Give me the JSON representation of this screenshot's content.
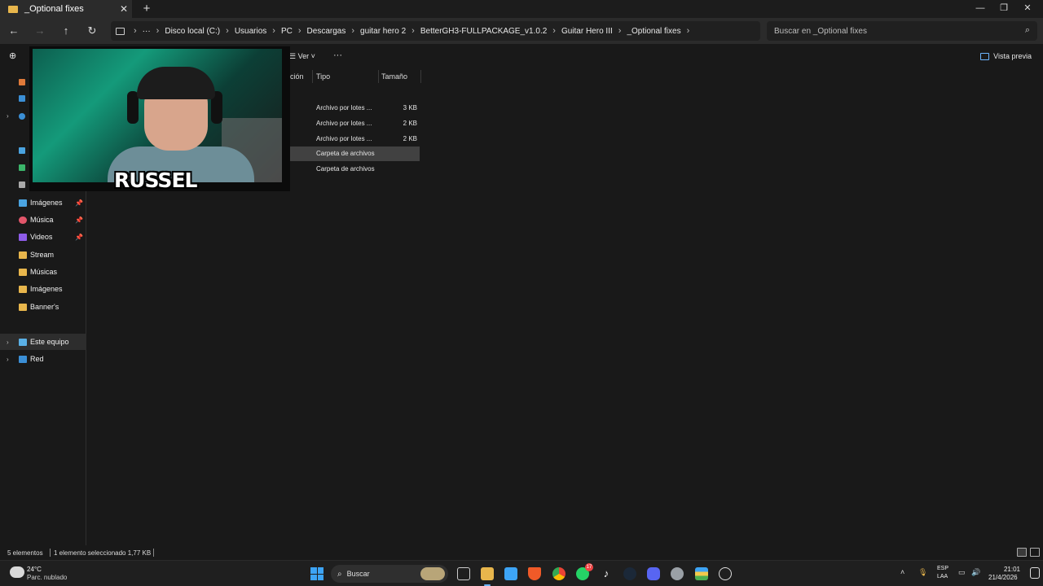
{
  "window": {
    "tab_title": "_Optional fixes",
    "tab_close": "✕",
    "new_tab": "+",
    "minimize": "—",
    "maximize": "❐",
    "close": "✕"
  },
  "address": {
    "crumbs": [
      "Disco local (C:)",
      "Usuarios",
      "PC",
      "Descargas",
      "guitar hero 2",
      "BetterGH3-FULLPACKAGE_v1.0.2",
      "Guitar Hero III",
      "_Optional fixes"
    ],
    "more": "···",
    "search_placeholder": "Buscar en _Optional fixes"
  },
  "toolbar": {
    "view_label": "Ver",
    "more_label": "···",
    "preview_label": "Vista previa"
  },
  "columns": {
    "partial_name": "ción",
    "type": "Tipo",
    "size": "Tamaño"
  },
  "files": [
    {
      "type": "Archivo por lotes ...",
      "size": "3 KB",
      "selected": false
    },
    {
      "type": "Archivo por lotes ...",
      "size": "2 KB",
      "selected": false
    },
    {
      "type": "Archivo por lotes ...",
      "size": "2 KB",
      "selected": false
    },
    {
      "type": "Carpeta de archivos",
      "size": "",
      "selected": true
    },
    {
      "type": "Carpeta de archivos",
      "size": "",
      "selected": false
    }
  ],
  "sidebar": {
    "pinned": [
      {
        "label": "Imágenes",
        "icon": "images-icon"
      },
      {
        "label": "Música",
        "icon": "music-icon"
      },
      {
        "label": "Videos",
        "icon": "videos-icon"
      }
    ],
    "folders": [
      "Stream",
      "Músicas",
      "Imágenes",
      "Banner's"
    ],
    "this_pc": "Este equipo",
    "network": "Red"
  },
  "webcam": {
    "overlay_name": "RUSSEL"
  },
  "status": {
    "count": "5 elementos",
    "selection": "1 elemento seleccionado  1,77 KB"
  },
  "taskbar": {
    "temp": "24°C",
    "weather": "Parc. nublado",
    "search": "Buscar",
    "whatsapp_badge": "17",
    "lang1": "ESP",
    "lang2": "LAA",
    "time": "21:01",
    "date": "21/4/2026"
  },
  "colors": {
    "accent": "#6cb5ff",
    "folder": "#e8b64c",
    "selection": "#414141"
  }
}
